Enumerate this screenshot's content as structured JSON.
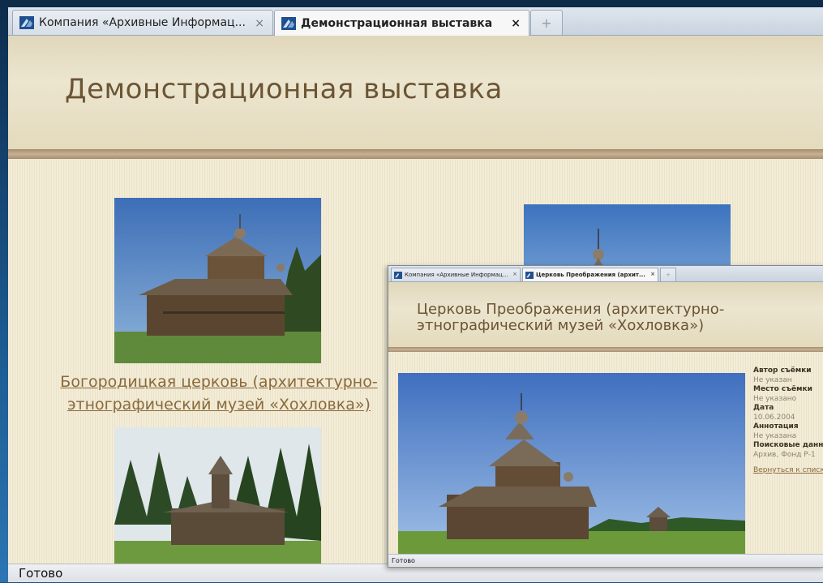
{
  "browser": {
    "tabs": [
      {
        "label": "Компания «Архивные Информац...",
        "active": false
      },
      {
        "label": "Демонстрационная выставка",
        "active": true
      }
    ],
    "close_symbol": "×",
    "new_tab_symbol": "+",
    "favicon": "archive-favicon-icon"
  },
  "page": {
    "title": "Демонстрационная выставка",
    "items": [
      {
        "label": "Богородицкая церковь (архитектурно-этнографический музей «Хохловка»)"
      }
    ]
  },
  "status": "Готово",
  "popup": {
    "tabs": [
      {
        "label": "Компания «Архивные Информац...",
        "active": false
      },
      {
        "label": "Церковь Преображения (архит...",
        "active": true
      }
    ],
    "close_symbol": "×",
    "new_tab_symbol": "+",
    "title": "Церковь Преображения (архитектурно-этнографический музей «Хохловка»)",
    "meta": {
      "author_label": "Автор съёмки",
      "author_value": "Не указан",
      "place_label": "Место съёмки",
      "place_value": "Не указано",
      "date_label": "Дата",
      "date_value": "10.06.2004",
      "annotation_label": "Аннотация",
      "annotation_value": "Не указана",
      "search_label": "Поисковые данные",
      "search_value": "Архив, Фонд Р-1",
      "back_link": "Вернуться к списку"
    },
    "status": "Готово"
  },
  "colors": {
    "title": "#6b5535",
    "link": "#8a6a3c",
    "header_rule": "#a58b6c"
  }
}
